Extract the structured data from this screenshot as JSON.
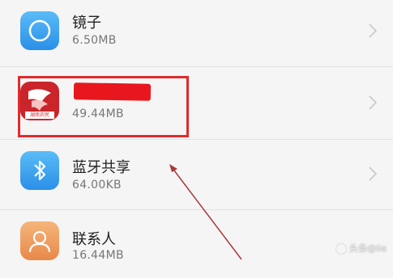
{
  "apps": [
    {
      "name": "镜子",
      "size": "6.50MB",
      "icon": "mirror-icon",
      "color": "#3da8f5"
    },
    {
      "name": "",
      "size": "49.44MB",
      "icon": "app-logo-icon",
      "color": "#c9252b",
      "logo_text": "湖南农民",
      "name_redacted": true
    },
    {
      "name": "蓝牙共享",
      "size": "64.00KB",
      "icon": "bluetooth-icon",
      "color": "#3da8f5"
    },
    {
      "name": "联系人",
      "size": "16.44MB",
      "icon": "contacts-icon",
      "color": "#f0a160"
    }
  ],
  "annotation": {
    "highlight_color": "#e02b2b",
    "redact_color": "#e8171e"
  },
  "watermark": "头条@lie"
}
